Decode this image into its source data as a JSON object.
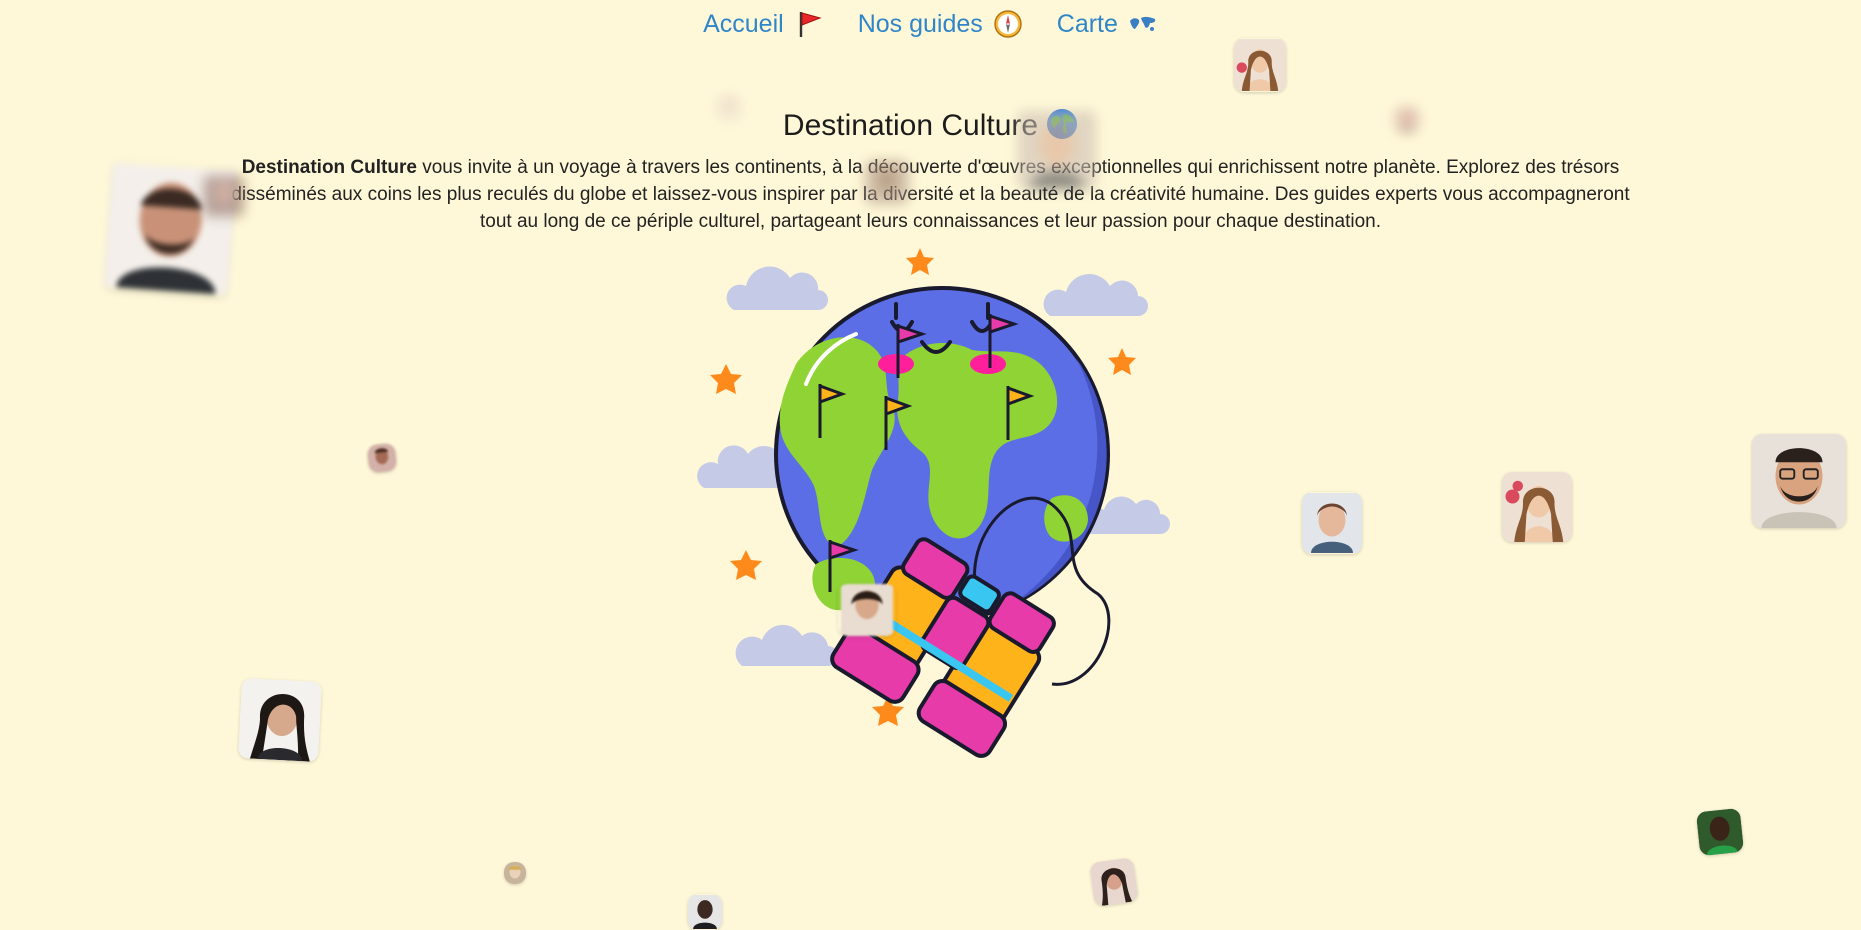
{
  "nav": {
    "items": [
      {
        "label": "Accueil",
        "icon": "red-flag-icon"
      },
      {
        "label": "Nos guides",
        "icon": "compass-icon"
      },
      {
        "label": "Carte",
        "icon": "world-map-icon"
      }
    ],
    "link_color": "#2f86c8"
  },
  "page": {
    "title": "Destination Culture",
    "title_icon": "globe-icon",
    "intro_brand": "Destination Culture",
    "intro_text": " vous invite à un voyage à travers les continents, à la découverte d'œuvres exceptionnelles qui enrichissent notre planète. Explorez des trésors disséminés aux coins les plus reculés du globe et laissez-vous inspirer par la diversité et la beauté de la créativité humaine. Des guides experts vous accompagneront tout au long de ce périple culturel, partageant leurs connaissances et leur passion pour chaque destination.",
    "background": "#fff8d8"
  },
  "hero": {
    "image": "globe-with-binoculars-illustration"
  },
  "guides": {
    "avatar_icon": "guide-avatar-icon"
  }
}
